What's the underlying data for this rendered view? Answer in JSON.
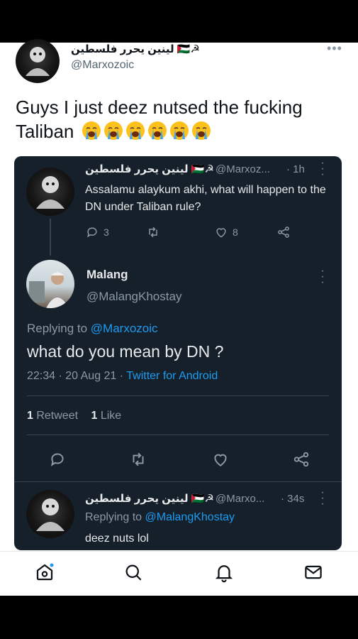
{
  "outer_tweet": {
    "display_name": "لينين يحرر فلسطين 🇵🇸☭",
    "handle": "@Marxozoic",
    "more": "•••",
    "text": "Guys I just deez nutsed the fucking Taliban",
    "emoji_count": 6
  },
  "screenshot": {
    "first_reply": {
      "display_name": "لينين يحرر فلسطين 🇵🇸☭",
      "handle": "@Marxoz...",
      "time": "· 1h",
      "text": "Assalamu alaykum akhi, what will happen to the DN under Taliban rule?",
      "replies": "3",
      "likes": "8"
    },
    "main_tweet": {
      "display_name": "Malang",
      "handle": "@MalangKhostay",
      "replying_prefix": "Replying to ",
      "replying_to": "@Marxozoic",
      "text": "what do you mean by DN ?",
      "timestamp": "22:34 · 20 Aug 21 · ",
      "source": "Twitter for Android",
      "retweet_count": "1",
      "retweet_label": " Retweet",
      "like_count": "1",
      "like_label": " Like"
    },
    "last_reply": {
      "display_name": "لينين يحرر فلسطين 🇵🇸☭",
      "handle": "@Marxo...",
      "time": "· 34s",
      "replying_prefix": "Replying to ",
      "replying_to": "@MalangKhostay",
      "text": "deez nuts lol"
    }
  },
  "bottom_nav": [
    "home-icon",
    "search-icon",
    "notifications-icon",
    "messages-icon"
  ],
  "colors": {
    "dark_bg": "#15202b",
    "accent": "#1d9bf0",
    "muted": "#8b98a5"
  }
}
